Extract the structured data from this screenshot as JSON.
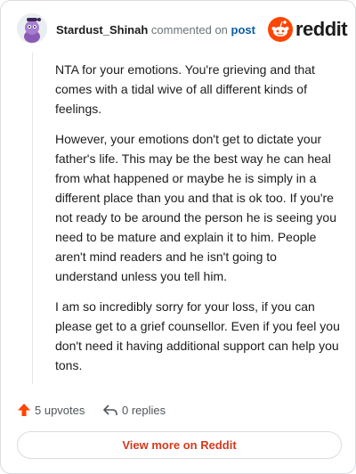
{
  "header": {
    "author": "Stardust_Shinah",
    "commented_text": "commented on",
    "post_link": "post",
    "brand": "reddit"
  },
  "comment": {
    "paragraphs": [
      "NTA for your emotions. You're grieving and that comes with a tidal wive of all different kinds of feelings.",
      "However, your emotions don't get to dictate your father's life. This may be the best way he can heal from what happened or maybe he is simply in a different place than you and that is ok too. If you're not ready to be around the person he is seeing you need to be mature and explain it to him. People aren't mind readers and he isn't going to understand unless you tell him.",
      "I am so incredibly sorry for your loss, if you can please get to a grief counsellor. Even if you feel you don't need it having additional support can help you tons."
    ]
  },
  "actions": {
    "upvotes": "5 upvotes",
    "replies": "0 replies"
  },
  "footer": {
    "view_more": "View more on Reddit"
  },
  "colors": {
    "brand_orange": "#ff4500",
    "link_blue": "#0a5ea8",
    "view_more_red": "#d33a1e"
  },
  "icons": [
    "snoo-avatar-icon",
    "reddit-logo-icon",
    "upvote-arrow-icon",
    "reply-arrow-icon"
  ]
}
